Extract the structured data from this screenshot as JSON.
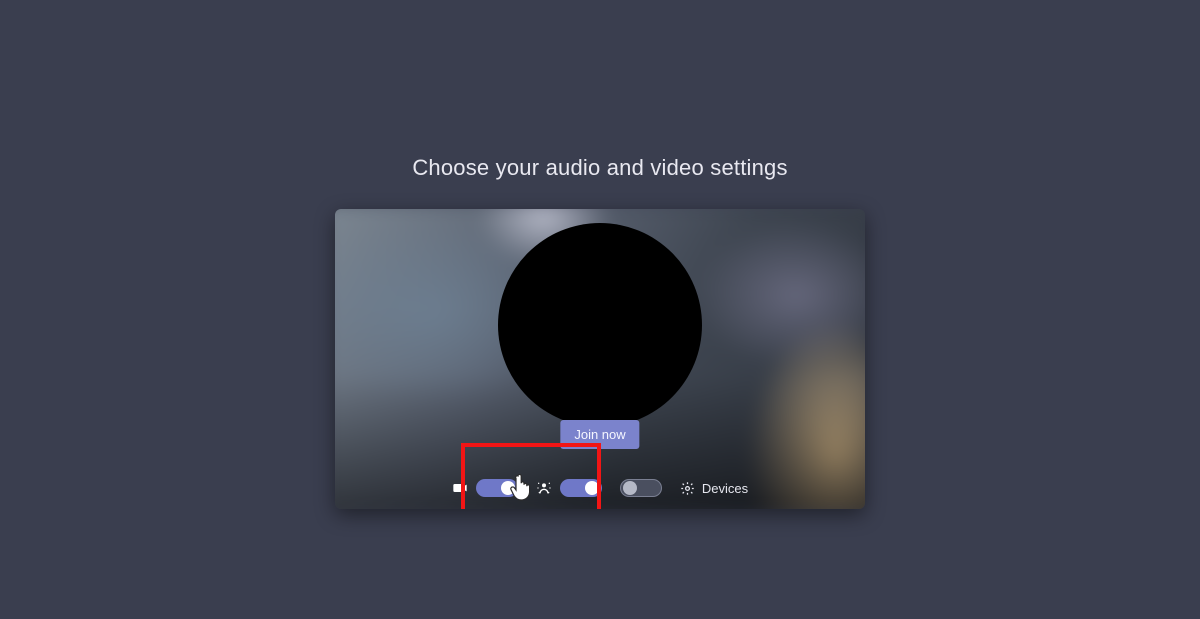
{
  "heading": "Choose your audio and video settings",
  "join_button": {
    "label": "Join now"
  },
  "controls": {
    "camera": {
      "icon": "video-icon",
      "on": true
    },
    "blur": {
      "icon": "background-blur-icon",
      "on": true
    },
    "mic": {
      "icon": "microphone-icon",
      "on": false
    },
    "devices_label": "Devices"
  },
  "annotation": {
    "highlight_color": "#f21515"
  }
}
